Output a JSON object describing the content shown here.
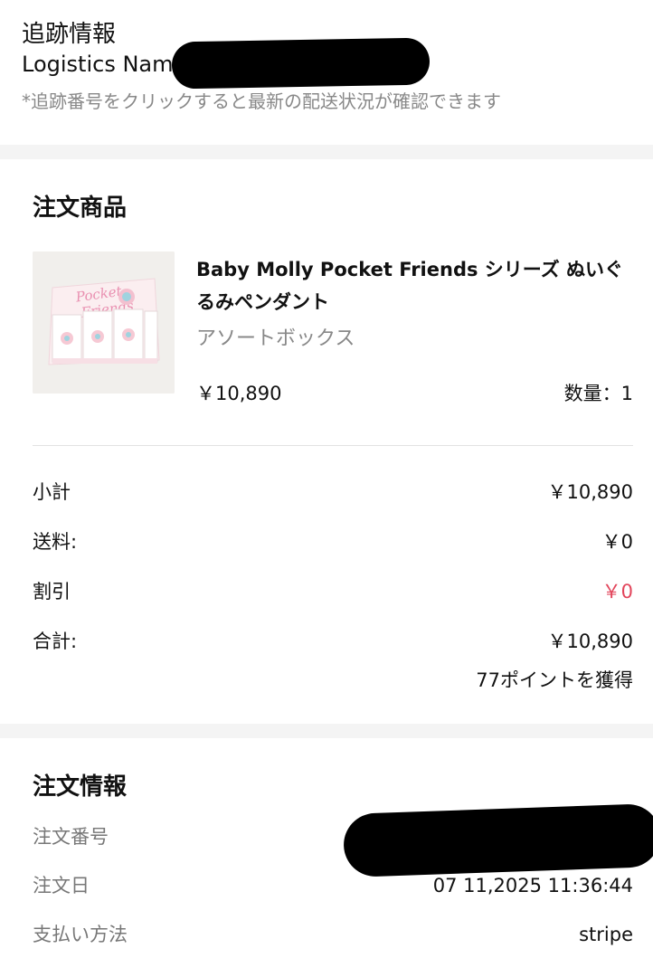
{
  "tracking": {
    "title": "追跡情報",
    "logistics_name": "Logistics Name:",
    "note": "*追跡番号をクリックすると最新の配送状況が確認できます"
  },
  "order_items": {
    "title": "注文商品",
    "product": {
      "name": "Baby Molly Pocket Friends シリーズ ぬいぐるみペンダント",
      "variant": "アソートボックス",
      "price": "￥10,890",
      "quantity": "数量：1",
      "thumbnail_text": "Pocket Friends"
    },
    "summary": [
      {
        "label": "小計",
        "value": "￥10,890",
        "color": "#111111"
      },
      {
        "label": "送料:",
        "value": "￥0",
        "color": "#111111"
      },
      {
        "label": "割引",
        "value": "￥0",
        "color": "#e2455b"
      },
      {
        "label": "合計:",
        "value": "￥10,890",
        "color": "#111111"
      }
    ],
    "points": "77ポイントを獲得"
  },
  "order_info": {
    "title": "注文情報",
    "rows": [
      {
        "label": "注文番号",
        "value": ""
      },
      {
        "label": "注文日",
        "value": "07 11,2025 11:36:44"
      },
      {
        "label": "支払い方法",
        "value": "stripe"
      }
    ]
  },
  "colors": {
    "background": "#f4f4f4",
    "card": "#ffffff",
    "muted_text": "#888888",
    "discount_red": "#e2455b"
  }
}
